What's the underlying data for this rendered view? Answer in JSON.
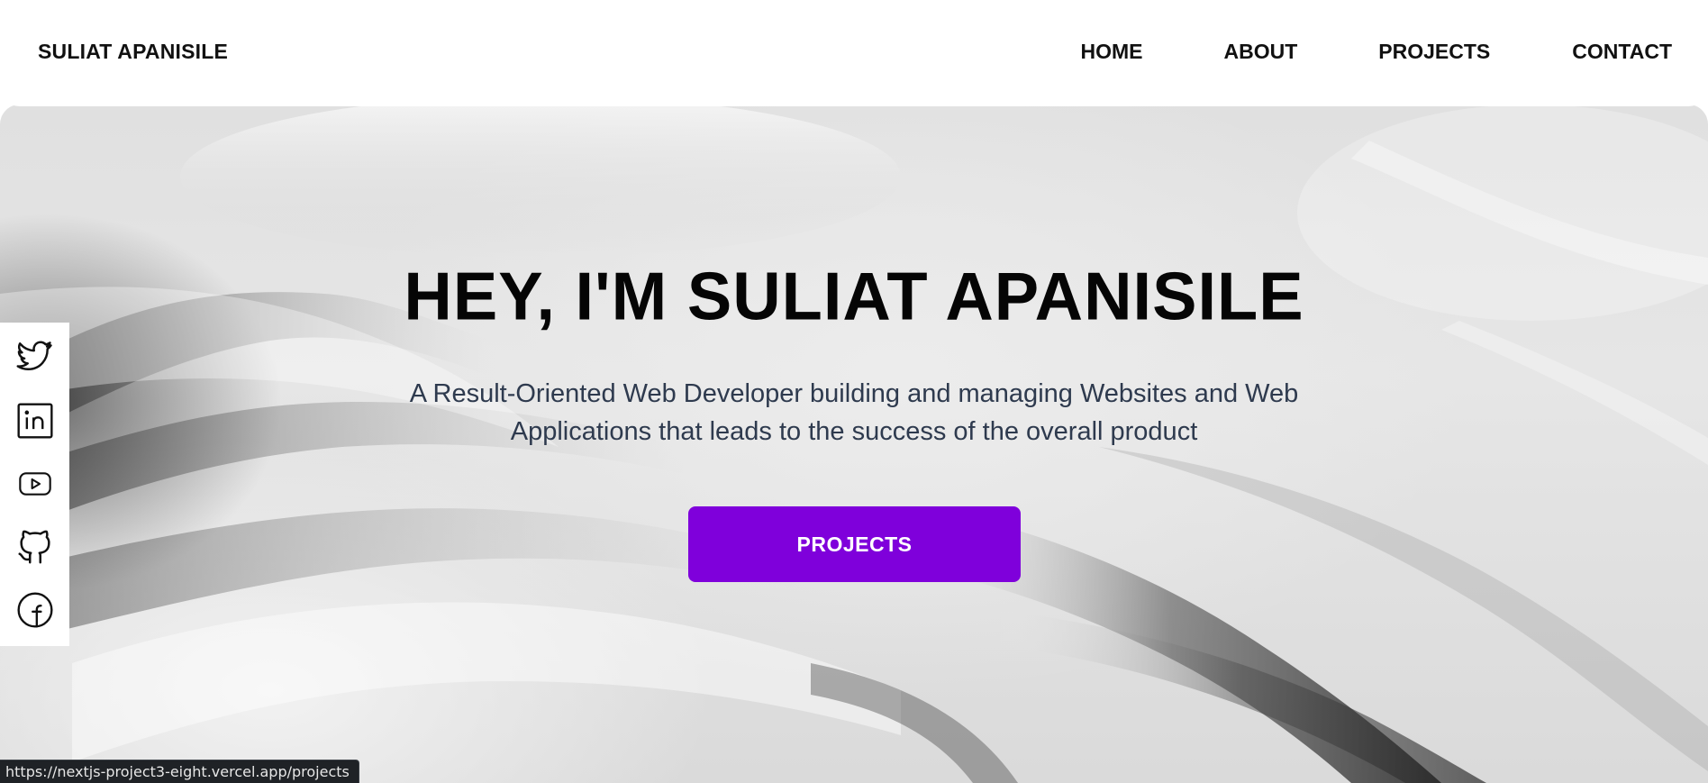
{
  "header": {
    "brand": "SULIAT APANISILE",
    "nav": {
      "home": "HOME",
      "about": "ABOUT",
      "projects": "PROJECTS",
      "contact": "CONTACT"
    }
  },
  "hero": {
    "title": "HEY, I'M SULIAT APANISILE",
    "subtitle_line1": "A Result-Oriented Web Developer building and managing Websites and Web",
    "subtitle_line2": "Applications that leads to the success of the overall product",
    "button_label": "PROJECTS",
    "button_color": "#7f00db"
  },
  "social": {
    "icons": [
      "twitter-icon",
      "linkedin-icon",
      "youtube-icon",
      "github-icon",
      "facebook-icon"
    ]
  },
  "statusbar": {
    "url": "https://nextjs-project3-eight.vercel.app/projects"
  }
}
